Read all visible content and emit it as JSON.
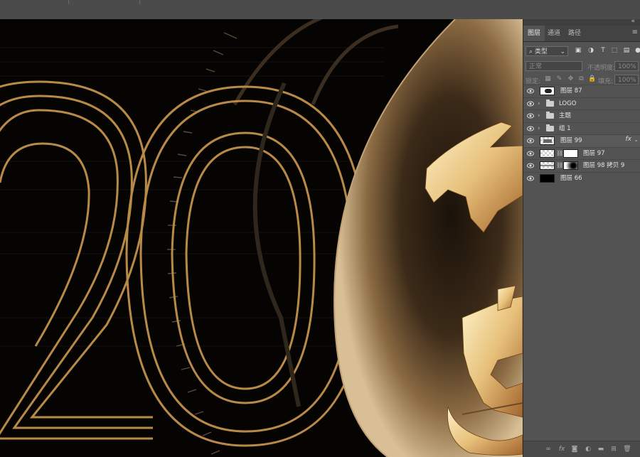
{
  "panel": {
    "tabs": [
      "图层",
      "通道",
      "路径"
    ],
    "active_tab": 0,
    "filter": {
      "kind_label": "类型"
    },
    "blend": {
      "mode": "正常",
      "opacity_label": "不透明度:",
      "opacity_value": "100%"
    },
    "lock": {
      "label": "锁定:",
      "fill_label": "填充:",
      "fill_value": "100%"
    },
    "layers": [
      {
        "name": "图层 87",
        "kind": "layer",
        "thumb": "checker-white"
      },
      {
        "name": "LOGO",
        "kind": "group"
      },
      {
        "name": "主题",
        "kind": "group"
      },
      {
        "name": "组 1",
        "kind": "group"
      },
      {
        "name": "图层 99",
        "kind": "layer",
        "thumb": "checker-dark",
        "fx": "fx"
      },
      {
        "name": "图层 97",
        "kind": "masked",
        "thumb": "checker",
        "mask": "white"
      },
      {
        "name": "图层 98 拷贝 9",
        "kind": "masked",
        "thumb": "checker",
        "mask": "radial"
      },
      {
        "name": "图层 66",
        "kind": "layer",
        "thumb": "black"
      }
    ]
  },
  "colors": {
    "gold": "#c49a55",
    "panel": "#535353",
    "canvas_bg": "#050403"
  },
  "icons": {
    "bottom": [
      "link-icon",
      "fx-icon",
      "mask-icon",
      "adjustment-icon",
      "new-group-icon",
      "new-layer-icon",
      "delete-icon"
    ]
  }
}
